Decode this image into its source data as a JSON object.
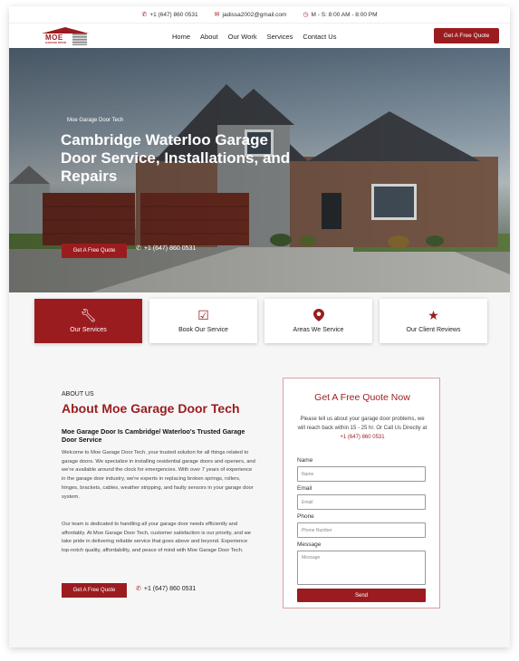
{
  "topbar": {
    "phone": "+1 (647) 860 0531",
    "email": "jadissa2002@gmail.com",
    "hours": "M - S: 8:00 AM - 8:00 PM"
  },
  "logo": {
    "text": "MOE",
    "sub": "GARAGE DOOR"
  },
  "nav": {
    "items": [
      "Home",
      "About",
      "Our Work",
      "Services",
      "Contact Us"
    ],
    "cta": "Get A Free Quote"
  },
  "hero": {
    "eyebrow": "Moe Garage Door Tech",
    "title": "Cambridge Waterloo Garage Door Service, Installations, and Repairs",
    "cta": "Get A Free Quote",
    "phone": "+1 (647) 860 0531"
  },
  "cards": [
    {
      "label": "Our Services",
      "icon": "wrench-icon"
    },
    {
      "label": "Book Our Service",
      "icon": "calendar-check-icon"
    },
    {
      "label": "Areas We Service",
      "icon": "map-pin-icon"
    },
    {
      "label": "Our Client Reviews",
      "icon": "star-icon"
    }
  ],
  "about": {
    "eyebrow": "ABOUT US",
    "title": "About Moe Garage Door Tech",
    "subtitle": "Moe Garage Door Is Cambridge/ Waterloo's Trusted Garage Door Service",
    "p1": "Welcome to Moe Garage Door Tech, your trusted solution for all things related to garage doors. We specialize in installing residential garage doors and openers, and we're available around the clock for emergencies. With over 7 years of experience in the garage door industry, we're experts in replacing broken springs, rollers, hinges, brackets, cables, weather stripping, and faulty sensors in your garage door system.",
    "p2": "Our team is dedicated to handling all your garage door needs efficiently and affordably. At Moe Garage Door Tech, customer satisfaction is our priority, and we take pride in delivering reliable service that goes above and beyond. Experience top-notch quality, affordability, and peace of mind with Moe Garage Door Tech.",
    "cta": "Get A Free Quote",
    "phone": "+1 (647) 860 0531"
  },
  "form": {
    "title": "Get A Free Quote Now",
    "intro": "Please tell us about your garage door problems, we will reach back within 15 - 25 hr. Or Call Us Directly at",
    "intro_phone": "+1 (647) 860 0531",
    "name_label": "Name",
    "name_placeholder": "Name",
    "email_label": "Email",
    "email_placeholder": "Email",
    "phone_label": "Phone",
    "phone_placeholder": "Phone Number",
    "message_label": "Message",
    "message_placeholder": "Message",
    "send": "Send"
  },
  "colors": {
    "brand": "#9b1c1f"
  }
}
